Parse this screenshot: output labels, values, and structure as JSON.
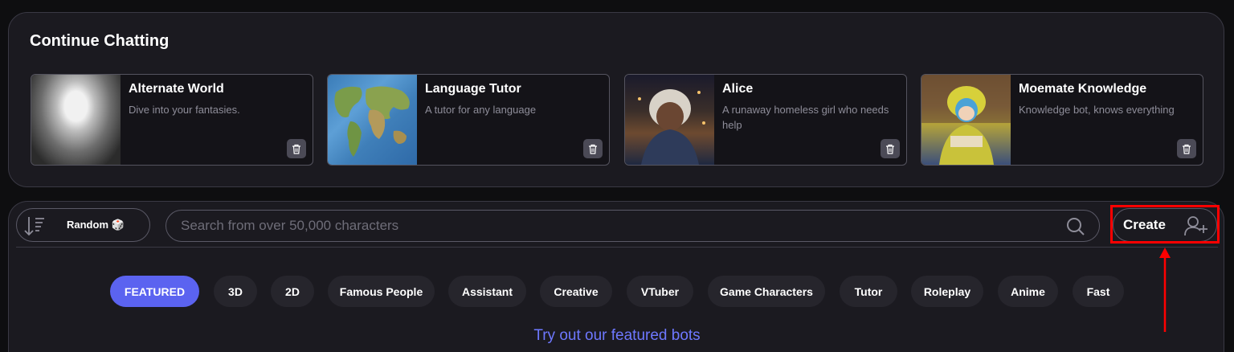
{
  "continue_chatting": {
    "title": "Continue Chatting",
    "cards": [
      {
        "name": "Alternate World",
        "desc": "Dive into your fantasies."
      },
      {
        "name": "Language Tutor",
        "desc": "A tutor for any language"
      },
      {
        "name": "Alice",
        "desc": "A runaway homeless girl who needs help"
      },
      {
        "name": "Moemate Knowledge",
        "desc": "Knowledge bot, knows everything"
      }
    ]
  },
  "toolbar": {
    "sort_label": "Random 🎲",
    "search_placeholder": "Search from over 50,000 characters",
    "create_label": "Create"
  },
  "categories": [
    "FEATURED",
    "3D",
    "2D",
    "Famous People",
    "Assistant",
    "Creative",
    "VTuber",
    "Game Characters",
    "Tutor",
    "Roleplay",
    "Anime",
    "Fast"
  ],
  "featured_text": "Try out our featured bots",
  "colors": {
    "accent": "#5b63f0",
    "link": "#6e78ff",
    "annotation": "#ff0000"
  }
}
